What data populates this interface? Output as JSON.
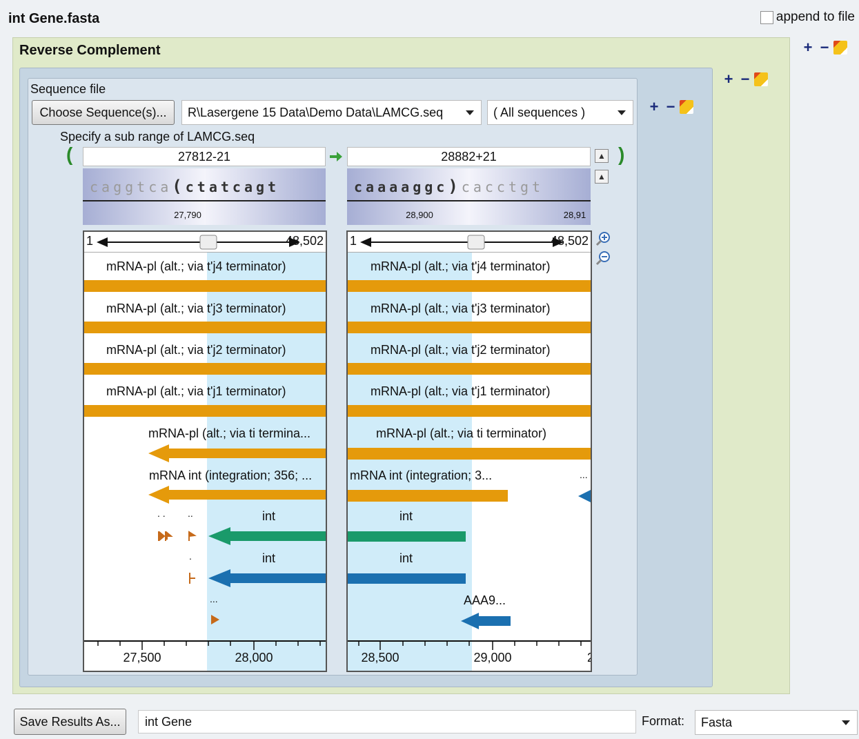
{
  "window": {
    "title": "int Gene.fasta",
    "append_label": "append to file"
  },
  "panel": {
    "title": "Reverse Complement"
  },
  "sequence": {
    "section_label": "Sequence file",
    "choose_label": "Choose Sequence(s)...",
    "path": "R\\Lasergene 15 Data\\Demo Data\\LAMCG.seq",
    "filter": "( All sequences )",
    "subrange_label": "Specify a sub range of LAMCG.seq",
    "open_paren": "(",
    "close_paren": ")"
  },
  "left": {
    "pos": "27812-21",
    "seq_dim": "caggtca",
    "seq_paren": "(",
    "seq_bold": "ctatcagt",
    "ruler": "27,790",
    "range_start": "1",
    "range_end": "48,502",
    "axis": [
      "27,500",
      "28,000"
    ]
  },
  "right": {
    "pos": "28882+21",
    "seq_bold": "caaaaggc",
    "seq_paren": ")",
    "seq_dim": "cacctgt",
    "ruler": [
      "28,900",
      "28,91"
    ],
    "range_start": "1",
    "range_end": "48,502",
    "axis": [
      "28,500",
      "29,000",
      "2"
    ]
  },
  "features": {
    "j4": "mRNA-pl (alt.; via t'j4 terminator)",
    "j3": "mRNA-pl (alt.; via t'j3 terminator)",
    "j2": "mRNA-pl (alt.; via t'j2 terminator)",
    "j1": "mRNA-pl (alt.; via t'j1 terminator)",
    "ti_left": "mRNA-pl (alt.; via ti termina...",
    "ti_right": "mRNA-pl (alt.; via ti terminator)",
    "int_left": "mRNA int (integration; 356; ...",
    "int_right": "mRNA int (integration; 3...",
    "int_gene": "int",
    "aaa": "AAA9...",
    "ellipsis": "...",
    "dots2": "..",
    "dot": ".",
    "dots_sep": ". ."
  },
  "colors": {
    "orange": "#e59a0b",
    "green": "#1a9a6a",
    "blue": "#1b70b0",
    "highlight": "#d0ecf9"
  },
  "bottom": {
    "save_label": "Save Results As...",
    "output_name": "int Gene",
    "format_label": "Format:",
    "format_value": "Fasta"
  }
}
